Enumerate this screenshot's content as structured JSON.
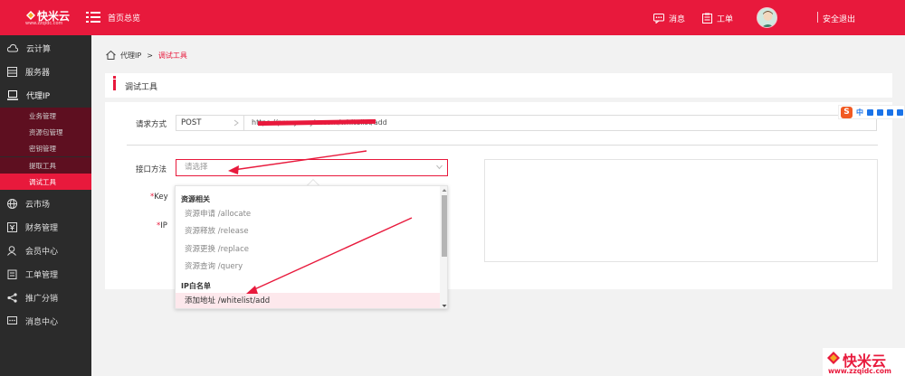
{
  "brand": {
    "name": "快米云",
    "url": "www.zzqidc.com",
    "color": "#e8193c"
  },
  "topbar": {
    "home_label": "首页总览",
    "messages_label": "消息",
    "tickets_label": "工单",
    "logout_label": "安全退出"
  },
  "sidebar": {
    "items": [
      {
        "label": "云计算",
        "icon": "cloud-icon"
      },
      {
        "label": "服务器",
        "icon": "server-icon"
      },
      {
        "label": "代理IP",
        "icon": "monitor-icon"
      },
      {
        "label": "云市场",
        "icon": "globe-icon"
      },
      {
        "label": "财务管理",
        "icon": "wallet-icon"
      },
      {
        "label": "会员中心",
        "icon": "user-icon"
      },
      {
        "label": "工单管理",
        "icon": "clipboard-icon"
      },
      {
        "label": "推广分销",
        "icon": "share-icon"
      },
      {
        "label": "消息中心",
        "icon": "message-icon"
      }
    ],
    "subitems": [
      {
        "label": "业务管理"
      },
      {
        "label": "资源包管理"
      },
      {
        "label": "密钥管理"
      },
      {
        "label": "提取工具"
      },
      {
        "label": "调试工具",
        "active": true
      }
    ]
  },
  "breadcrumb": {
    "parent": "代理IP",
    "separator": ">",
    "current": "调试工具"
  },
  "page_title": "调试工具",
  "form": {
    "method_label": "请求方式",
    "method_value": "POST",
    "url_value": "https://proxy.wuyin.com/whitelist/add",
    "interface_label": "接口方法",
    "interface_placeholder": "请选择",
    "key_label": "Key",
    "ip_label": "IP",
    "required_mark": "*"
  },
  "dropdown": {
    "groups": [
      {
        "label": "资源相关",
        "options": [
          "资源申请 /allocate",
          "资源释放 /release",
          "资源更换 /replace",
          "资源查询 /query"
        ]
      },
      {
        "label": "IP白名单",
        "options": [
          "添加地址 /whitelist/add"
        ]
      }
    ]
  },
  "ime": {
    "logo": "S",
    "mode": "中"
  },
  "watermark": {
    "name": "快米云",
    "url": "www.zzqidc.com"
  }
}
